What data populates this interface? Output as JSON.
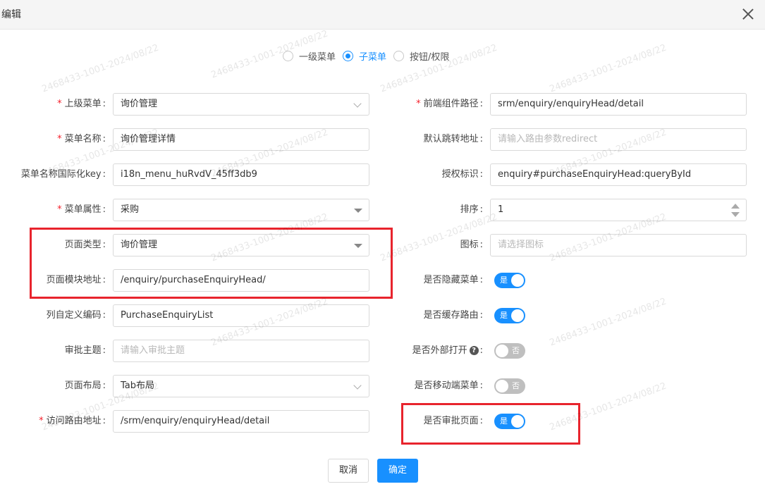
{
  "dialog": {
    "title": "编辑",
    "close_icon": "close-icon"
  },
  "menu_type": {
    "options": [
      "一级菜单",
      "子菜单",
      "按钮/权限"
    ],
    "selected": "子菜单"
  },
  "form_left": {
    "parent_menu": {
      "label": "上级菜单",
      "value": "询价管理"
    },
    "menu_name": {
      "label": "菜单名称",
      "value": "询价管理详情"
    },
    "i18n_key": {
      "label": "菜单名称国际化key",
      "value": "i18n_menu_huRvdV_45ff3db9"
    },
    "menu_attr": {
      "label": "菜单属性",
      "value": "采购"
    },
    "page_type": {
      "label": "页面类型",
      "value": "询价管理"
    },
    "module_path": {
      "label": "页面模块地址",
      "value": "/enquiry/purchaseEnquiryHead/"
    },
    "column_code": {
      "label": "列自定义编码",
      "value": "PurchaseEnquiryList"
    },
    "approval_subject": {
      "label": "审批主题",
      "placeholder": "请输入审批主题"
    },
    "page_layout": {
      "label": "页面布局",
      "value": "Tab布局"
    },
    "route_path": {
      "label": "访问路由地址",
      "value": "/srm/enquiry/enquiryHead/detail"
    }
  },
  "form_right": {
    "component_path": {
      "label": "前端组件路径",
      "value": "srm/enquiry/enquiryHead/detail"
    },
    "redirect": {
      "label": "默认跳转地址",
      "placeholder": "请输入路由参数redirect"
    },
    "permission": {
      "label": "授权标识",
      "value": "enquiry#purchaseEnquiryHead:queryById"
    },
    "sort": {
      "label": "排序",
      "value": "1"
    },
    "icon": {
      "label": "图标",
      "placeholder": "请选择图标"
    },
    "hide_menu": {
      "label": "是否隐藏菜单",
      "state": "是"
    },
    "cache_route": {
      "label": "是否缓存路由",
      "state": "是"
    },
    "external_open": {
      "label": "是否外部打开",
      "state": "否",
      "help_icon": "question-circle-icon",
      "help_glyph": "?"
    },
    "mobile_menu": {
      "label": "是否移动端菜单",
      "state": "否"
    },
    "approval_page": {
      "label": "是否审批页面",
      "state": "是"
    }
  },
  "footer": {
    "cancel_label": "取消",
    "confirm_label": "确定"
  },
  "colors": {
    "primary": "#1890ff",
    "highlight_box": "#e8242d",
    "required": "#f5222d"
  },
  "watermark": "2468433-1001-2024/08/22"
}
